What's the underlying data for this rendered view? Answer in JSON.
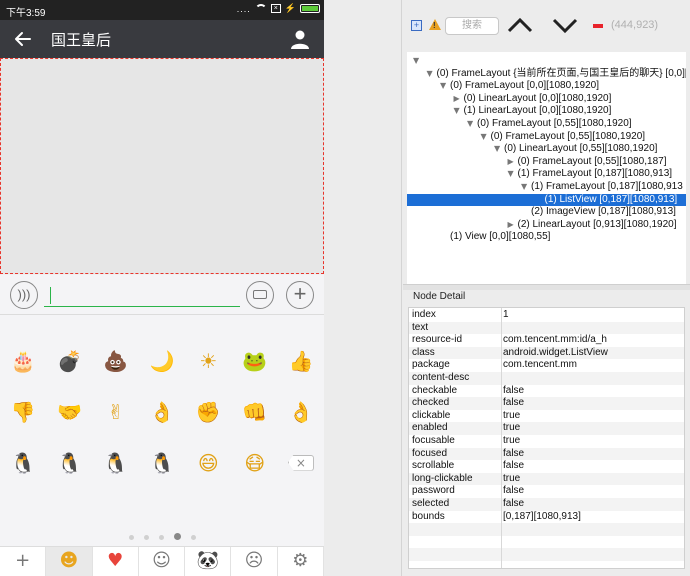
{
  "status_bar": {
    "time": "下午3:59",
    "signal": "....",
    "box_label": "×"
  },
  "chat": {
    "title": "国王皇后"
  },
  "input": {
    "voice_icon": "voice-icon",
    "keyboard_icon": "keyboard-icon",
    "plus_label": "+"
  },
  "emoji_panel": {
    "rows": [
      [
        "🎂",
        "💣",
        "💩",
        "🌙",
        "☀",
        "🐸",
        "👍"
      ],
      [
        "👎",
        "🤝",
        "✌",
        "👌",
        "✊",
        "👊",
        "👌"
      ],
      [
        "🐧",
        "🐧",
        "🐧",
        "🐧",
        "😄",
        "😷",
        "×"
      ]
    ],
    "page_count": 5,
    "current_page": 4
  },
  "emoji_tabs": [
    {
      "label": "+"
    },
    {
      "label": "☻"
    },
    {
      "label": "♥"
    },
    {
      "label": "☺"
    },
    {
      "label": "🐼"
    },
    {
      "label": "☹"
    },
    {
      "label": "⚙"
    }
  ],
  "toolbar": {
    "search_placeholder": "搜索",
    "expand_label": "+",
    "warn_label": "!",
    "coords": "(444,923)"
  },
  "tree": [
    {
      "depth": 0,
      "arrow": "▼",
      "label": "",
      "selected": false
    },
    {
      "depth": 1,
      "arrow": "▼",
      "label": "(0) FrameLayout {当前所在页面,与国王皇后的聊天} [0,0][1",
      "selected": false
    },
    {
      "depth": 2,
      "arrow": "▼",
      "label": "(0) FrameLayout [0,0][1080,1920]",
      "selected": false
    },
    {
      "depth": 3,
      "arrow": "▶",
      "label": "(0) LinearLayout [0,0][1080,1920]",
      "selected": false
    },
    {
      "depth": 3,
      "arrow": "▼",
      "label": "(1) LinearLayout [0,0][1080,1920]",
      "selected": false
    },
    {
      "depth": 4,
      "arrow": "▼",
      "label": "(0) FrameLayout [0,55][1080,1920]",
      "selected": false
    },
    {
      "depth": 5,
      "arrow": "▼",
      "label": "(0) FrameLayout [0,55][1080,1920]",
      "selected": false
    },
    {
      "depth": 6,
      "arrow": "▼",
      "label": "(0) LinearLayout [0,55][1080,1920]",
      "selected": false
    },
    {
      "depth": 7,
      "arrow": "▶",
      "label": "(0) FrameLayout [0,55][1080,187]",
      "selected": false
    },
    {
      "depth": 7,
      "arrow": "▼",
      "label": "(1) FrameLayout [0,187][1080,913]",
      "selected": false
    },
    {
      "depth": 8,
      "arrow": "▼",
      "label": "(1) FrameLayout [0,187][1080,913",
      "selected": false
    },
    {
      "depth": 9,
      "arrow": "",
      "label": "(1) ListView [0,187][1080,913]",
      "selected": true
    },
    {
      "depth": 8,
      "arrow": "",
      "label": "(2) ImageView [0,187][1080,913]",
      "selected": false
    },
    {
      "depth": 7,
      "arrow": "▶",
      "label": "(2) LinearLayout [0,913][1080,1920]",
      "selected": false
    },
    {
      "depth": 2,
      "arrow": "",
      "label": "(1) View [0,0][1080,55]",
      "selected": false
    }
  ],
  "node_detail": {
    "title": "Node Detail",
    "rows": [
      {
        "key": "index",
        "value": "1"
      },
      {
        "key": "text",
        "value": ""
      },
      {
        "key": "resource-id",
        "value": "com.tencent.mm:id/a_h"
      },
      {
        "key": "class",
        "value": "android.widget.ListView"
      },
      {
        "key": "package",
        "value": "com.tencent.mm"
      },
      {
        "key": "content-desc",
        "value": ""
      },
      {
        "key": "checkable",
        "value": "false"
      },
      {
        "key": "checked",
        "value": "false"
      },
      {
        "key": "clickable",
        "value": "true"
      },
      {
        "key": "enabled",
        "value": "true"
      },
      {
        "key": "focusable",
        "value": "true"
      },
      {
        "key": "focused",
        "value": "false"
      },
      {
        "key": "scrollable",
        "value": "false"
      },
      {
        "key": "long-clickable",
        "value": "true"
      },
      {
        "key": "password",
        "value": "false"
      },
      {
        "key": "selected",
        "value": "false"
      },
      {
        "key": "bounds",
        "value": "[0,187][1080,913]"
      },
      {
        "key": "",
        "value": ""
      },
      {
        "key": "",
        "value": ""
      },
      {
        "key": "",
        "value": ""
      },
      {
        "key": "",
        "value": ""
      }
    ]
  },
  "colors": {
    "accent_green": "#2bb449",
    "selection_blue": "#1c6ed6",
    "title_bar": "#393a3f",
    "dashed_border": "#e8342b"
  }
}
